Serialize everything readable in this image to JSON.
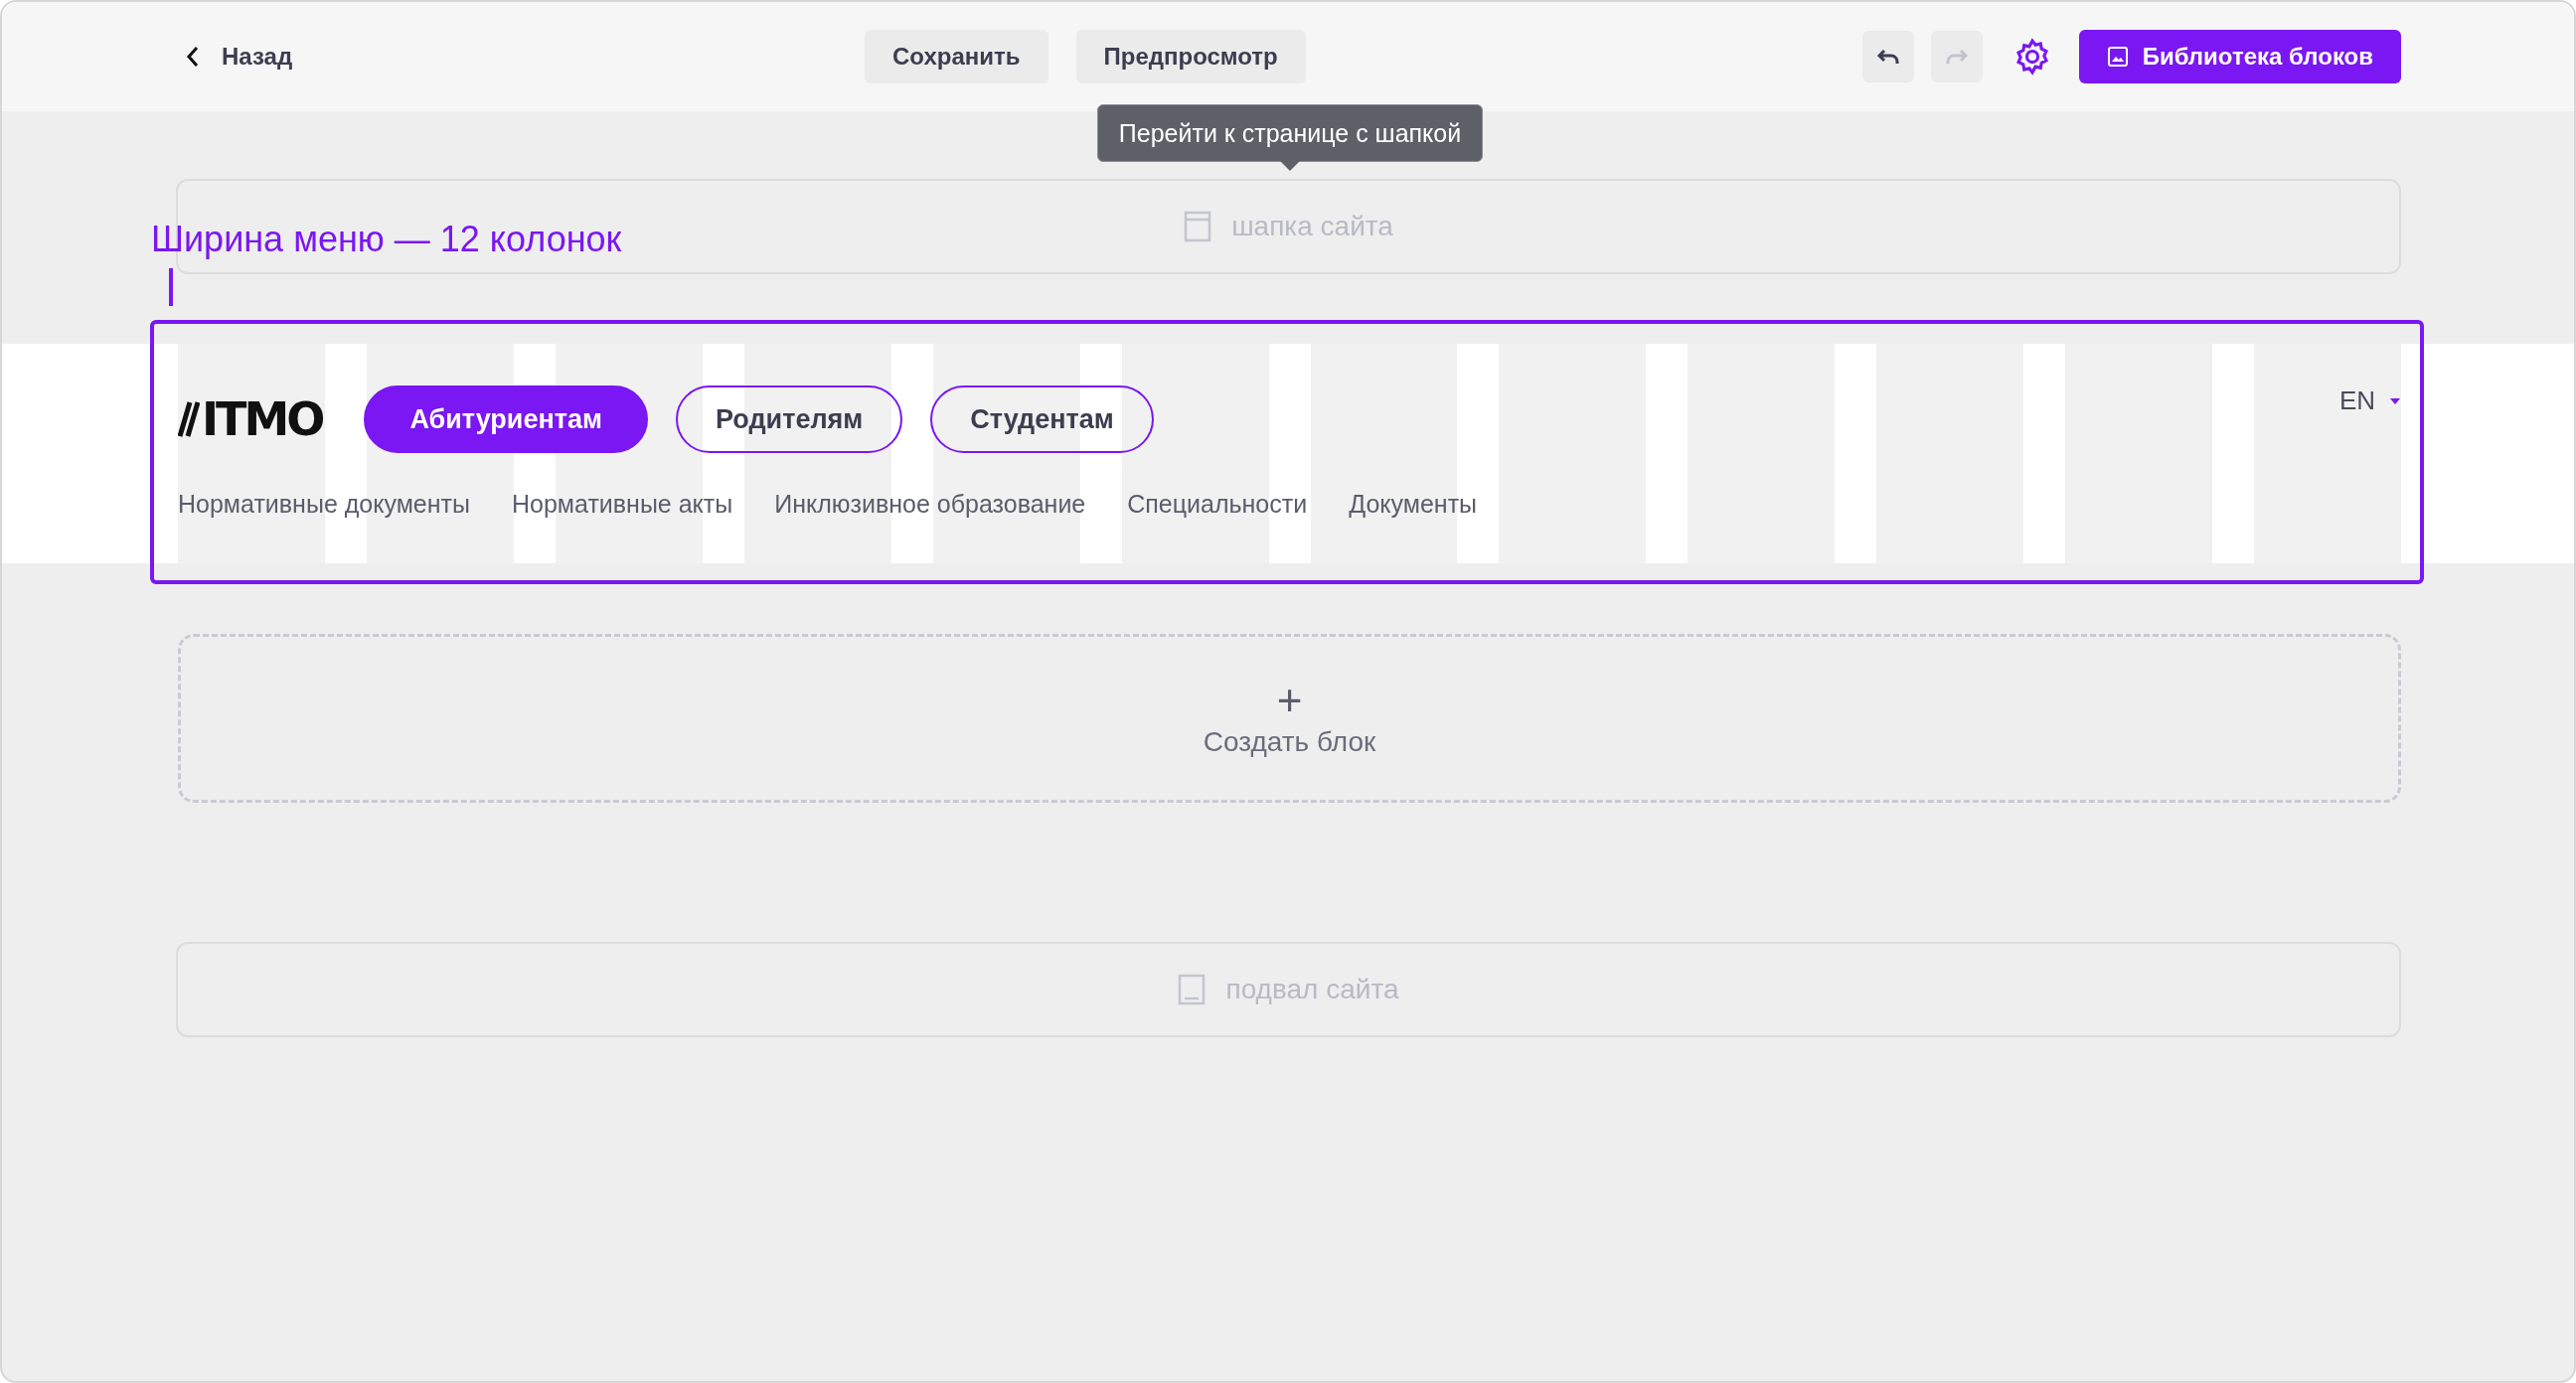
{
  "topbar": {
    "back": "Назад",
    "buttons": [
      "Сохранить",
      "Предпросмотр"
    ],
    "undo": {
      "disabled": false
    },
    "redo": {
      "disabled": true
    },
    "library_button": "Библиотека блоков"
  },
  "tooltip": "Перейти к странице с шапкой",
  "header_block": {
    "label": "шапка сайта"
  },
  "annotation": "Ширина меню — 12 колонок",
  "menu": {
    "logo": "ITMO",
    "language": "EN",
    "tabs": [
      {
        "label": "Абитуриентам",
        "selected": true
      },
      {
        "label": "Родителям",
        "selected": false
      },
      {
        "label": "Студентам",
        "selected": false
      }
    ],
    "links": [
      "Нормативные документы",
      "Нормативные акты",
      "Инклюзивное образование",
      "Специальности",
      "Документы"
    ]
  },
  "create_block": {
    "icon": "+",
    "label": "Создать блок"
  },
  "footer_block": {
    "label": "подвал сайта"
  }
}
